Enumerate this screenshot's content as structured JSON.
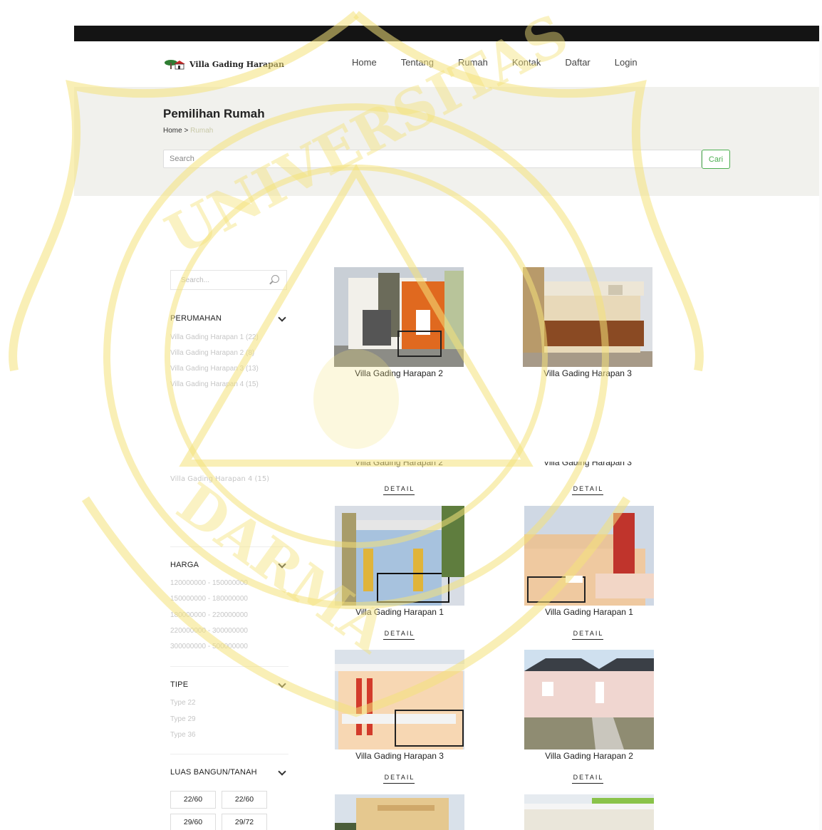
{
  "header": {
    "brand": "Villa Gading Harapan",
    "nav": [
      "Home",
      "Tentang",
      "Rumah",
      "Kontak",
      "Daftar",
      "Login"
    ]
  },
  "banner": {
    "title": "Pemilihan Rumah",
    "breadcrumb_home": "Home",
    "breadcrumb_sep": ">",
    "breadcrumb_current": "Rumah",
    "search_placeholder": "Search",
    "search_button": "Cari"
  },
  "sidebar": {
    "search_placeholder": "Search...",
    "perumahan": {
      "title": "PERUMAHAN",
      "items": [
        "Villa Gading Harapan 1 (22)",
        "Villa Gading Harapan 2 (8)",
        "Villa Gading Harapan 3 (13)",
        "Villa Gading Harapan 4 (15)"
      ]
    },
    "repeat_item": "Villa Gading Harapan 4 (15)",
    "harga": {
      "title": "HARGA",
      "items": [
        "120000000 - 150000000",
        "150000000 - 180000000",
        "180000000 - 220000000",
        "220000000 - 300000000",
        "300000000 - 500000000"
      ]
    },
    "tipe": {
      "title": "TIPE",
      "items": [
        "Type 22",
        "Type 29",
        "Type 36"
      ]
    },
    "luas": {
      "title": "LUAS BANGUN/TANAH",
      "items": [
        "22/60",
        "22/60",
        "29/60",
        "29/72"
      ]
    }
  },
  "products": {
    "top_row": [
      "Villa Gading Harapan 2",
      "Villa Gading Harapan 3"
    ],
    "cut_row": [
      "Villa Gading Harapan 2",
      "Villa Gading Harapan 3"
    ],
    "row2": [
      "Villa Gading Harapan 1",
      "Villa Gading Harapan 1"
    ],
    "row3": [
      "Villa Gading Harapan 3",
      "Villa Gading Harapan 2"
    ],
    "detail_label": "DETAIL"
  },
  "watermark": {
    "text_top": "UNIVERSITAS",
    "text_bottom": "DARMA"
  },
  "colors": {
    "topbar": "#141414",
    "banner_bg": "#f1f1ed",
    "accent_green": "#4caf50",
    "watermark": "#f4e27a"
  }
}
